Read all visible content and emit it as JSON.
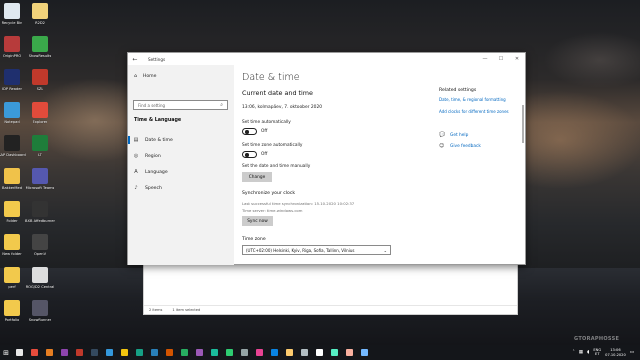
{
  "desktop": {
    "icons": [
      {
        "label": "Recycle Bin",
        "color": "#dfe8f0"
      },
      {
        "label": "R2D2",
        "color": "#f1d27a"
      },
      {
        "label": "OriginPRO",
        "color": "#b73b3b"
      },
      {
        "label": "ShowResults",
        "color": "#3aa94a"
      },
      {
        "label": "IDP Reader",
        "color": "#1f2f6e"
      },
      {
        "label": "SZL",
        "color": "#c0392b"
      },
      {
        "label": "Notepad",
        "color": "#3b9ad9"
      },
      {
        "label": "Explorer",
        "color": "#e14b3b"
      },
      {
        "label": "SAP Dashboard",
        "color": "#222"
      },
      {
        "label": "LT",
        "color": "#1e7d3a"
      },
      {
        "label": "BakkerMed",
        "color": "#f0c24a"
      },
      {
        "label": "Microsoft Teams",
        "color": "#5558af"
      },
      {
        "label": "Folder",
        "color": "#f2c94c"
      },
      {
        "label": "BXB Affedburner",
        "color": "#333"
      },
      {
        "label": "New folder",
        "color": "#f2c94c"
      },
      {
        "label": "OpenV",
        "color": "#444"
      },
      {
        "label": "perf",
        "color": "#f2c94c"
      },
      {
        "label": "ROG/D2 Central",
        "color": "#ddd"
      },
      {
        "label": "Portfolio",
        "color": "#f2c94c"
      },
      {
        "label": "SnowRunner",
        "color": "#556"
      }
    ]
  },
  "explorer": {
    "items_count": "2 items",
    "selected": "1 item selected"
  },
  "settings": {
    "window_title": "Settings",
    "controls": {
      "minimize": "—",
      "maximize": "☐",
      "close": "✕"
    },
    "nav": {
      "home": "Home",
      "search_placeholder": "Find a setting",
      "section": "Time & Language",
      "items": [
        {
          "label": "Date & time",
          "icon": "calendar-clock-icon",
          "active": true
        },
        {
          "label": "Region",
          "icon": "globe-icon",
          "active": false
        },
        {
          "label": "Language",
          "icon": "language-icon",
          "active": false
        },
        {
          "label": "Speech",
          "icon": "microphone-icon",
          "active": false
        }
      ]
    },
    "main": {
      "title": "Date & time",
      "subtitle": "Current date and time",
      "current_datetime": "13:06, kolmapäev, 7. oktoober 2020",
      "set_time_auto_label": "Set time automatically",
      "set_time_auto_state": "Off",
      "set_timezone_auto_label": "Set time zone automatically",
      "set_timezone_auto_state": "Off",
      "set_manually_label": "Set the date and time manually",
      "change_button": "Change",
      "sync_heading": "Synchronize your clock",
      "last_sync": "Last successful time synchronization: 15.10.2020 10:02:37",
      "time_server": "Time server: time.windows.com",
      "sync_button": "Sync now",
      "timezone_label": "Time zone",
      "timezone_value": "(UTC+02:00) Helsinki, Kyiv, Riga, Sofia, Tallinn, Vilnius"
    },
    "related": {
      "heading": "Related settings",
      "links": [
        "Date, time, & regional formatting",
        "Add clocks for different time zones"
      ],
      "help": "Get help",
      "feedback": "Give feedback"
    }
  },
  "taskbar": {
    "app_colors": [
      "#e8e8e8",
      "#e74c3c",
      "#e67e22",
      "#8e44ad",
      "#c0392b",
      "#34495e",
      "#3498db",
      "#f1c40f",
      "#16a085",
      "#2980b9",
      "#d35400",
      "#27ae60",
      "#9b59b6",
      "#1abc9c",
      "#2ecc71",
      "#95a5a6",
      "#e84393",
      "#0984e3",
      "#fdcb6e",
      "#b2bec3",
      "#ffffff",
      "#55efc4",
      "#fab1a0",
      "#74b9ff"
    ],
    "language": "ENG",
    "language_sub": "ET",
    "time": "13:06",
    "date": "07.10.2020"
  },
  "watermark": "GTORAPHOSSE"
}
